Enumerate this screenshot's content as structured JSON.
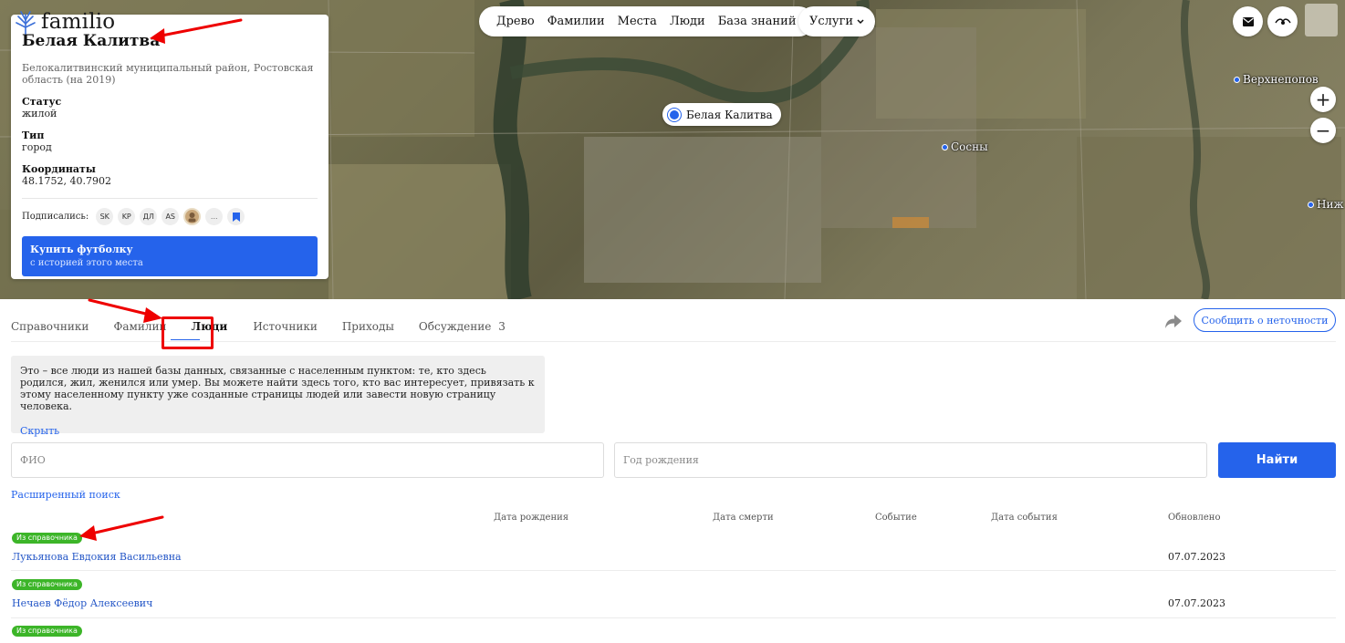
{
  "logo": {
    "text": "familio"
  },
  "place": {
    "title": "Белая Калитва",
    "subtitle": "Белокалитвинский муниципальный район, Ростовская область (на 2019)",
    "status_label": "Статус",
    "status_value": "жилой",
    "type_label": "Тип",
    "type_value": "город",
    "coords_label": "Координаты",
    "coords_value": "48.1752, 40.7902",
    "subscribers_label": "Подписались:",
    "subscribers": [
      "SK",
      "KP",
      "ДЛ",
      "AS"
    ],
    "subscribers_more": "...",
    "buy_title": "Купить футболку",
    "buy_sub": "с историей этого места"
  },
  "topnav": {
    "items": [
      "Древо",
      "Фамилии",
      "Места",
      "Люди",
      "База знаний"
    ],
    "services_label": "Услуги"
  },
  "map": {
    "main_marker": "Белая Калитва",
    "labels": [
      "Сосны",
      "Верхнепопов",
      "Ниж"
    ]
  },
  "tabs": {
    "items": [
      "Справочники",
      "Фамилии",
      "Люди",
      "Источники",
      "Приходы",
      "Обсуждение"
    ],
    "discussion_count": "3",
    "active": "Люди",
    "report_button": "Сообщить о неточности"
  },
  "info_box": {
    "text": "Это – все люди из нашей базы данных, связанные с населенным пунктом: те, кто здесь родился, жил, женился или умер. Вы можете найти здесь того, кто вас интересует, привязать к этому населенному пункту уже созданные страницы людей или завести новую страницу человека.",
    "hide_link": "Скрыть"
  },
  "search": {
    "name_placeholder": "ФИО",
    "year_placeholder": "Год рождения",
    "button": "Найти",
    "advanced_link": "Расширенный поиск"
  },
  "table": {
    "headers": [
      "Дата рождения",
      "Дата смерти",
      "Событие",
      "Дата события",
      "Обновлено"
    ],
    "rows": [
      {
        "badge": "Из справочника",
        "name": "Лукьянова Евдокия Васильевна",
        "updated": "07.07.2023"
      },
      {
        "badge": "Из справочника",
        "name": "Нечаев Фёдор Алексеевич",
        "updated": "07.07.2023"
      },
      {
        "badge": "Из справочника"
      }
    ]
  },
  "colors": {
    "accent": "#2563eb",
    "badge": "#3cb528",
    "annotation": "#e00000"
  }
}
